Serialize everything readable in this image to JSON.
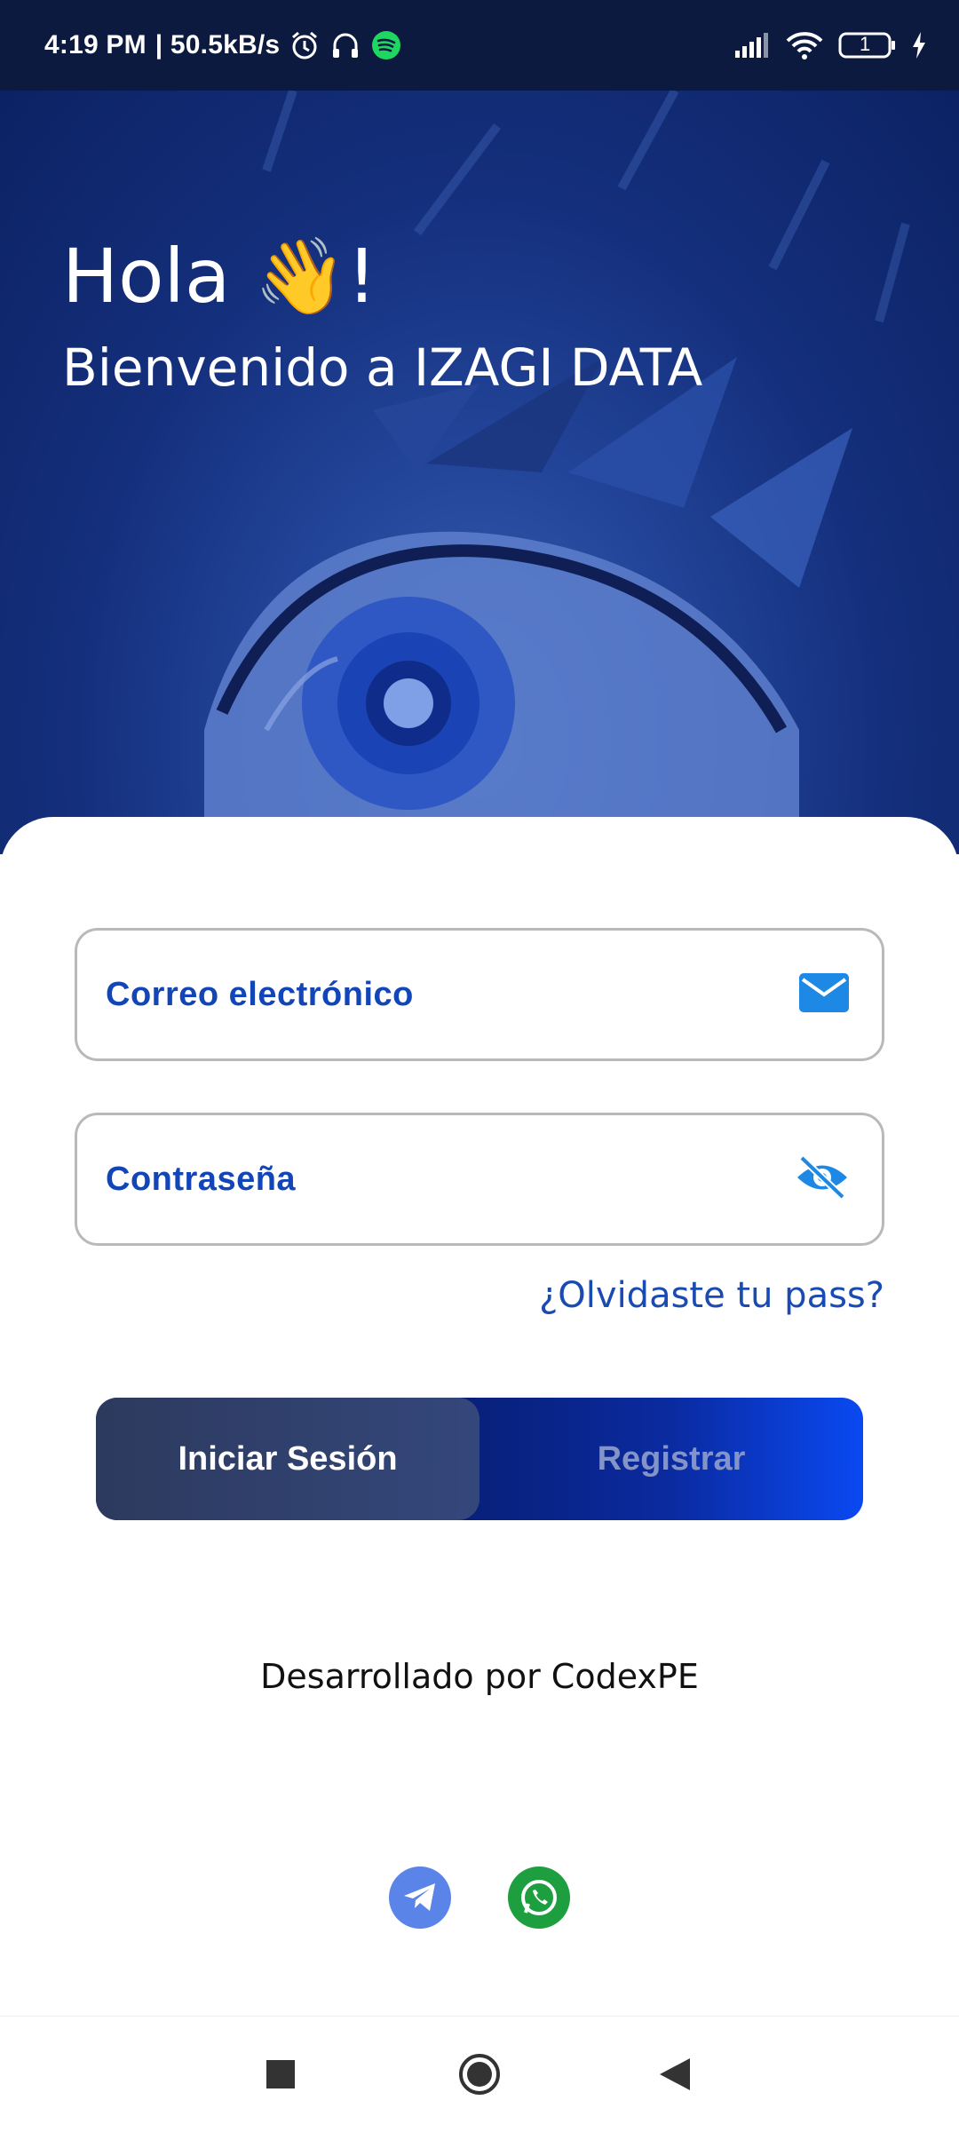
{
  "status_bar": {
    "time": "4:19 PM",
    "net_speed": "| 50.5kB/s",
    "battery_level": "1",
    "icons": [
      "alarm-icon",
      "headphones-icon",
      "spotify-icon",
      "signal-icon",
      "wifi-icon",
      "battery-icon",
      "charging-icon"
    ]
  },
  "hero": {
    "greeting": "Hola 👋!",
    "subtitle": "Bienvenido a IZAGI DATA"
  },
  "form": {
    "email_label": "Correo electrónico",
    "email_icon": "mail-icon",
    "password_label": "Contraseña",
    "password_icon": "eye-off-icon",
    "forgot_link": "¿Olvidaste tu pass?"
  },
  "toggle": {
    "login_label": "Iniciar Sesión",
    "register_label": "Registrar",
    "active": "login"
  },
  "footer": {
    "credits": "Desarrollado por CodexPE",
    "social": [
      "telegram-icon",
      "whatsapp-icon"
    ]
  },
  "colors": {
    "accent": "#1246b8",
    "hero_dark": "#0c2263",
    "whatsapp": "#1d9e3f",
    "telegram": "#5b84e8"
  }
}
